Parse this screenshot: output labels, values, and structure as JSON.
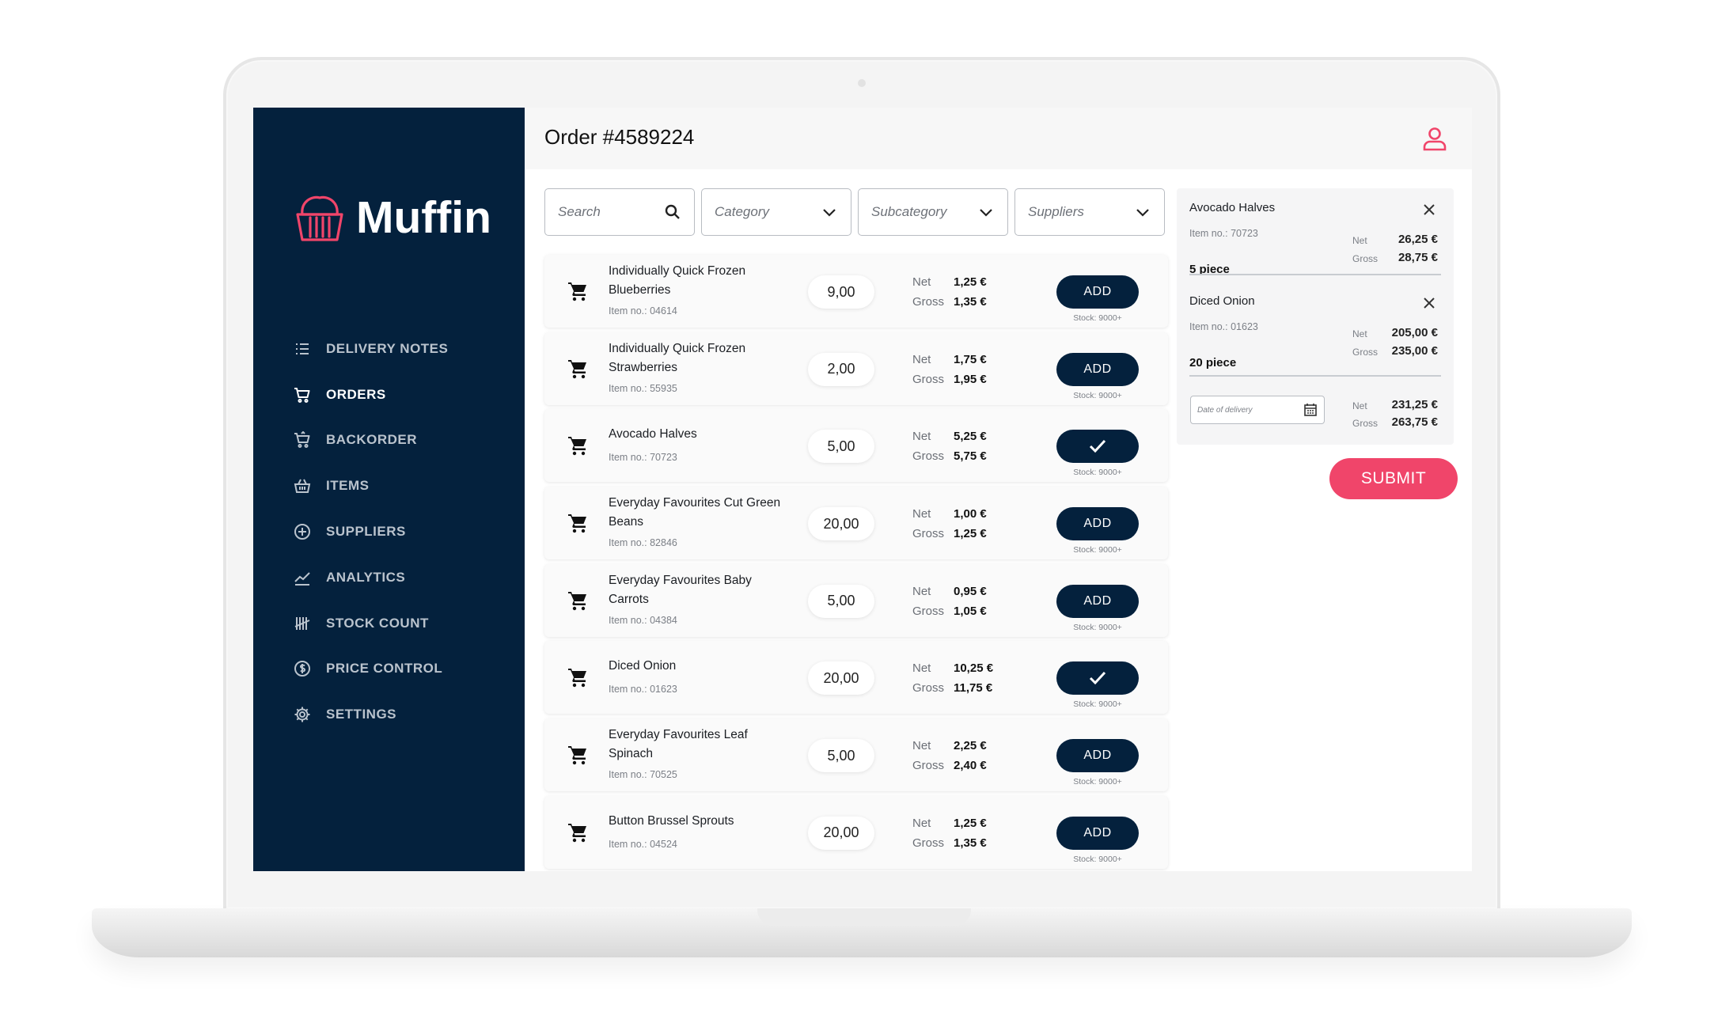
{
  "app": {
    "name": "Muffin"
  },
  "colors": {
    "sidebar_bg": "#04213d",
    "accent": "#f0456a",
    "button_dark": "#04213d"
  },
  "nav": {
    "items": [
      {
        "label": "DELIVERY NOTES",
        "icon": "list-icon",
        "active": false
      },
      {
        "label": "ORDERS",
        "icon": "cart-icon",
        "active": true
      },
      {
        "label": "BACKORDER",
        "icon": "cart-return-icon",
        "active": false
      },
      {
        "label": "ITEMS",
        "icon": "basket-icon",
        "active": false
      },
      {
        "label": "SUPPLIERS",
        "icon": "plus-circle-icon",
        "active": false
      },
      {
        "label": "ANALYTICS",
        "icon": "chart-line-icon",
        "active": false
      },
      {
        "label": "STOCK COUNT",
        "icon": "tally-icon",
        "active": false
      },
      {
        "label": "PRICE CONTROL",
        "icon": "dollar-circle-icon",
        "active": false
      },
      {
        "label": "SETTINGS",
        "icon": "gear-icon",
        "active": false
      }
    ]
  },
  "header": {
    "title": "Order #4589224",
    "user_icon": "user-icon"
  },
  "filters": {
    "search_placeholder": "Search",
    "category_placeholder": "Category",
    "subcategory_placeholder": "Subcategory",
    "suppliers_placeholder": "Suppliers"
  },
  "labels": {
    "net": "Net",
    "gross": "Gross",
    "add": "ADD"
  },
  "products": [
    {
      "name": "Individually Quick Frozen Blueberries",
      "item_no": "Item no.: 04614",
      "qty": "9,00",
      "net": "1,25 €",
      "gross": "1,35 €",
      "added": false,
      "stock": "Stock: 9000+"
    },
    {
      "name": "Individually Quick Frozen Strawberries",
      "item_no": "Item no.: 55935",
      "qty": "2,00",
      "net": "1,75 €",
      "gross": "1,95 €",
      "added": false,
      "stock": "Stock: 9000+"
    },
    {
      "name": "Avocado Halves",
      "item_no": "Item no.: 70723",
      "qty": "5,00",
      "net": "5,25 €",
      "gross": "5,75 €",
      "added": true,
      "stock": "Stock: 9000+"
    },
    {
      "name": "Everyday Favourites Cut Green Beans",
      "item_no": "Item no.: 82846",
      "qty": "20,00",
      "net": "1,00 €",
      "gross": "1,25 €",
      "added": false,
      "stock": "Stock: 9000+"
    },
    {
      "name": "Everyday Favourites Baby Carrots",
      "item_no": "Item no.: 04384",
      "qty": "5,00",
      "net": "0,95 €",
      "gross": "1,05 €",
      "added": false,
      "stock": "Stock: 9000+"
    },
    {
      "name": "Diced Onion",
      "item_no": "Item no.: 01623",
      "qty": "20,00",
      "net": "10,25 €",
      "gross": "11,75 €",
      "added": true,
      "stock": "Stock: 9000+"
    },
    {
      "name": "Everyday Favourites Leaf Spinach",
      "item_no": "Item no.: 70525",
      "qty": "5,00",
      "net": "2,25 €",
      "gross": "2,40 €",
      "added": false,
      "stock": "Stock: 9000+"
    },
    {
      "name": "Button Brussel Sprouts",
      "item_no": "Item no.: 04524",
      "qty": "20,00",
      "net": "1,25 €",
      "gross": "1,35 €",
      "added": false,
      "stock": "Stock: 9000+"
    }
  ],
  "summary": {
    "items": [
      {
        "name": "Avocado Halves",
        "item_no": "Item no.: 70723",
        "qty": "5 piece",
        "net": "26,25 €",
        "gross": "28,75 €"
      },
      {
        "name": "Diced Onion",
        "item_no": "Item no.: 01623",
        "qty": "20 piece",
        "net": "205,00 €",
        "gross": "235,00 €"
      }
    ],
    "date_placeholder": "Date of delivery",
    "total_net": "231,25 €",
    "total_gross": "263,75 €"
  },
  "submit_label": "SUBMIT"
}
